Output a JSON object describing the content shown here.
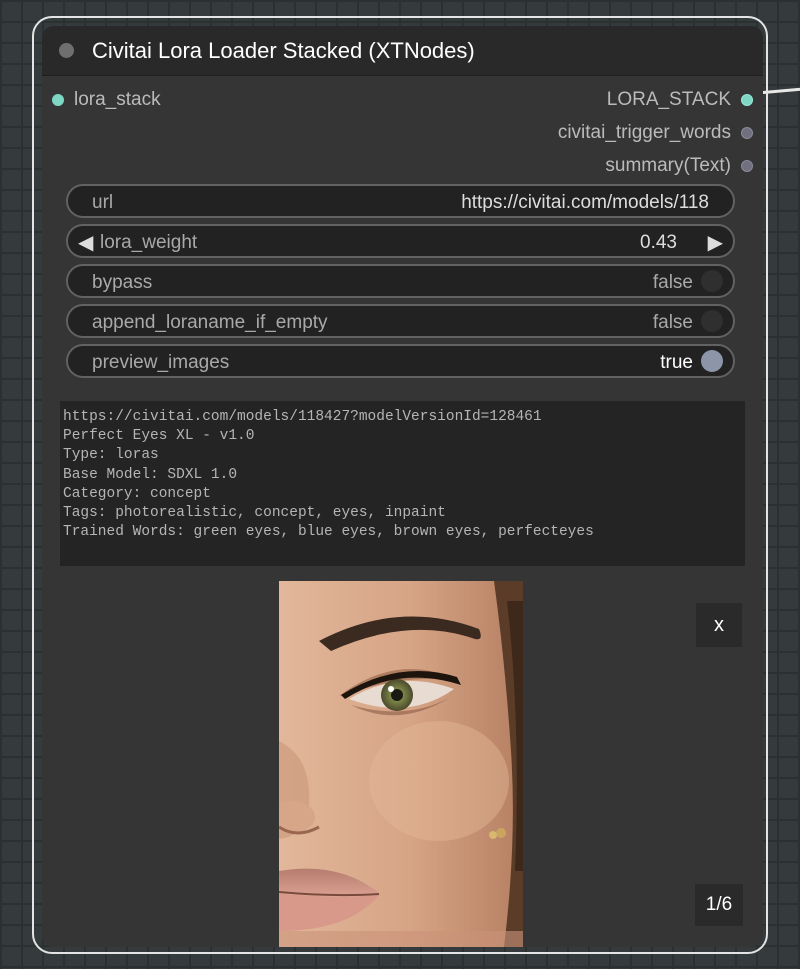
{
  "node": {
    "title": "Civitai Lora Loader Stacked (XTNodes)",
    "inputs": [
      {
        "label": "lora_stack",
        "color": "#7ed7c5"
      }
    ],
    "outputs": [
      {
        "label": "LORA_STACK",
        "color": "#7ed7c5"
      },
      {
        "label": "civitai_trigger_words",
        "color": "#707080"
      },
      {
        "label": "summary(Text)",
        "color": "#707080"
      }
    ]
  },
  "widgets": {
    "url": {
      "label": "url",
      "value": "https://civitai.com/models/118"
    },
    "lora_weight": {
      "label": "lora_weight",
      "value": "0.43",
      "left_arrow": "◀",
      "right_arrow": "▶"
    },
    "bypass": {
      "label": "bypass",
      "value": "false"
    },
    "append_loraname": {
      "label": "append_loraname_if_empty",
      "value": "false"
    },
    "preview_images": {
      "label": "preview_images",
      "value": "true"
    }
  },
  "summary_text": "https://civitai.com/models/118427?modelVersionId=128461\nPerfect Eyes XL - v1.0\nType: loras\nBase Model: SDXL 1.0\nCategory: concept\nTags: photorealistic, concept, eyes, inpaint\nTrained Words: green eyes, blue eyes, brown eyes, perfecteyes",
  "preview": {
    "close_label": "x",
    "counter": "1/6",
    "image_subject": "close-up of a woman's face with hazel eye"
  }
}
